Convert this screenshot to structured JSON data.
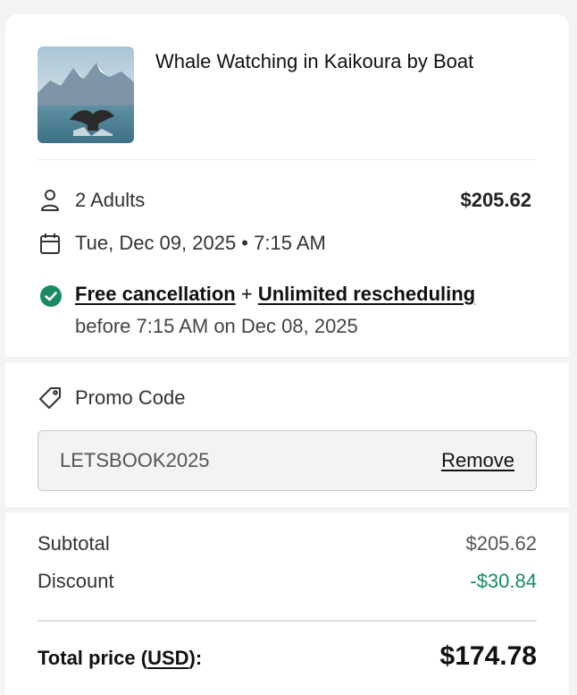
{
  "product": {
    "title": "Whale Watching in Kaikoura by Boat",
    "image_alt": "whale-tail-photo"
  },
  "booking": {
    "travelers": "2 Adults",
    "price": "$205.62",
    "date_time": "Tue, Dec 09, 2025 • 7:15 AM",
    "policy_free_cancel": "Free cancellation",
    "policy_plus": "+",
    "policy_reschedule": "Unlimited rescheduling",
    "policy_deadline": "before 7:15 AM on Dec 08, 2025"
  },
  "promo": {
    "label": "Promo Code",
    "code": "LETSBOOK2025",
    "remove_label": "Remove"
  },
  "totals": {
    "subtotal_label": "Subtotal",
    "subtotal_value": "$205.62",
    "discount_label": "Discount",
    "discount_value": "-$30.84",
    "total_label_prefix": "Total price (",
    "total_currency": "USD",
    "total_label_suffix": "):",
    "total_value": "$174.78"
  },
  "colors": {
    "accent_green": "#1a8a64",
    "background": "#f3f3f3"
  },
  "icons": [
    "person-icon",
    "calendar-icon",
    "check-circle-icon",
    "tag-icon"
  ]
}
